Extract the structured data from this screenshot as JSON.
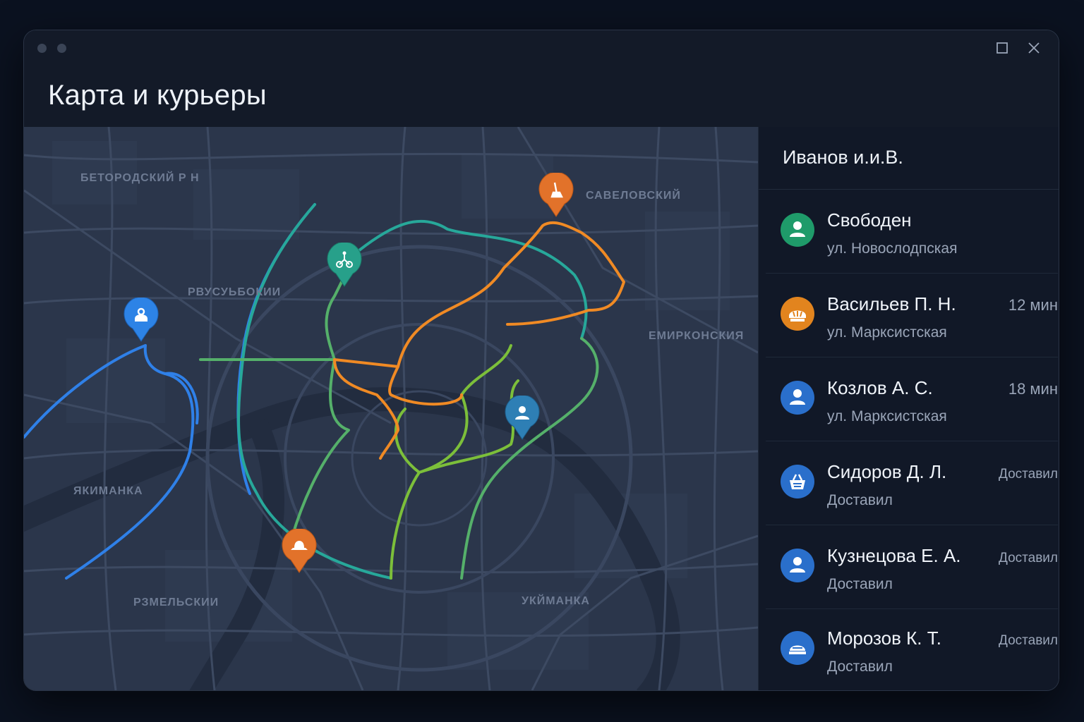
{
  "window": {
    "controls": {
      "maximize_icon": "square-icon",
      "close_icon": "close-icon"
    }
  },
  "header": {
    "title": "Карта и курьеры"
  },
  "map": {
    "districts": [
      "БЕТОРОДСКИЙ Р Н",
      "САВЕЛОВСКИЙ",
      "РВУСУЬБОКИИ",
      "ЕМИРКОНСКИЯ",
      "ЯКИМАНКА",
      "РЗМЕЛЬСКИИ",
      "УКЙМАНКА"
    ],
    "route_colors": {
      "blue": "#2f80e8",
      "teal": "#27a89a",
      "green": "#7cbf3a",
      "orange": "#f08a24"
    },
    "markers": [
      {
        "icon": "person-icon",
        "color": "#2d83e6"
      },
      {
        "icon": "bike-icon",
        "color": "#27a08a"
      },
      {
        "icon": "broom-icon",
        "color": "#e2722a"
      },
      {
        "icon": "person-icon",
        "color": "#2e7fb5"
      },
      {
        "icon": "hat-icon",
        "color": "#e2722a"
      }
    ]
  },
  "panel": {
    "title": "Иванов и.и.В.",
    "couriers": [
      {
        "name": "Свободен",
        "address": "ул. Новослодпская",
        "status": "",
        "avatar_color": "#1f9b6a",
        "avatar_icon": "person-icon"
      },
      {
        "name": "Васильев П. Н.",
        "address": "ул. Марксистская",
        "status": "12 мин",
        "avatar_color": "#e2841e",
        "avatar_icon": "bread-icon"
      },
      {
        "name": "Козлов А. С.",
        "address": "ул. Марксистская",
        "status": "18 мин",
        "avatar_color": "#2a6fcb",
        "avatar_icon": "person-icon"
      },
      {
        "name": "Сидоров Д. Л.",
        "address": "Доставил",
        "status": "Доставил",
        "avatar_color": "#2a6fcb",
        "avatar_icon": "basket-icon"
      },
      {
        "name": "Кузнецова Е. А.",
        "address": "Доставил",
        "status": "Доставил",
        "avatar_color": "#2a6fcb",
        "avatar_icon": "person-icon"
      },
      {
        "name": "Морозов К. Т.",
        "address": "Доставил",
        "status": "Доставил",
        "avatar_color": "#2a6fcb",
        "avatar_icon": "cap-icon"
      }
    ]
  }
}
